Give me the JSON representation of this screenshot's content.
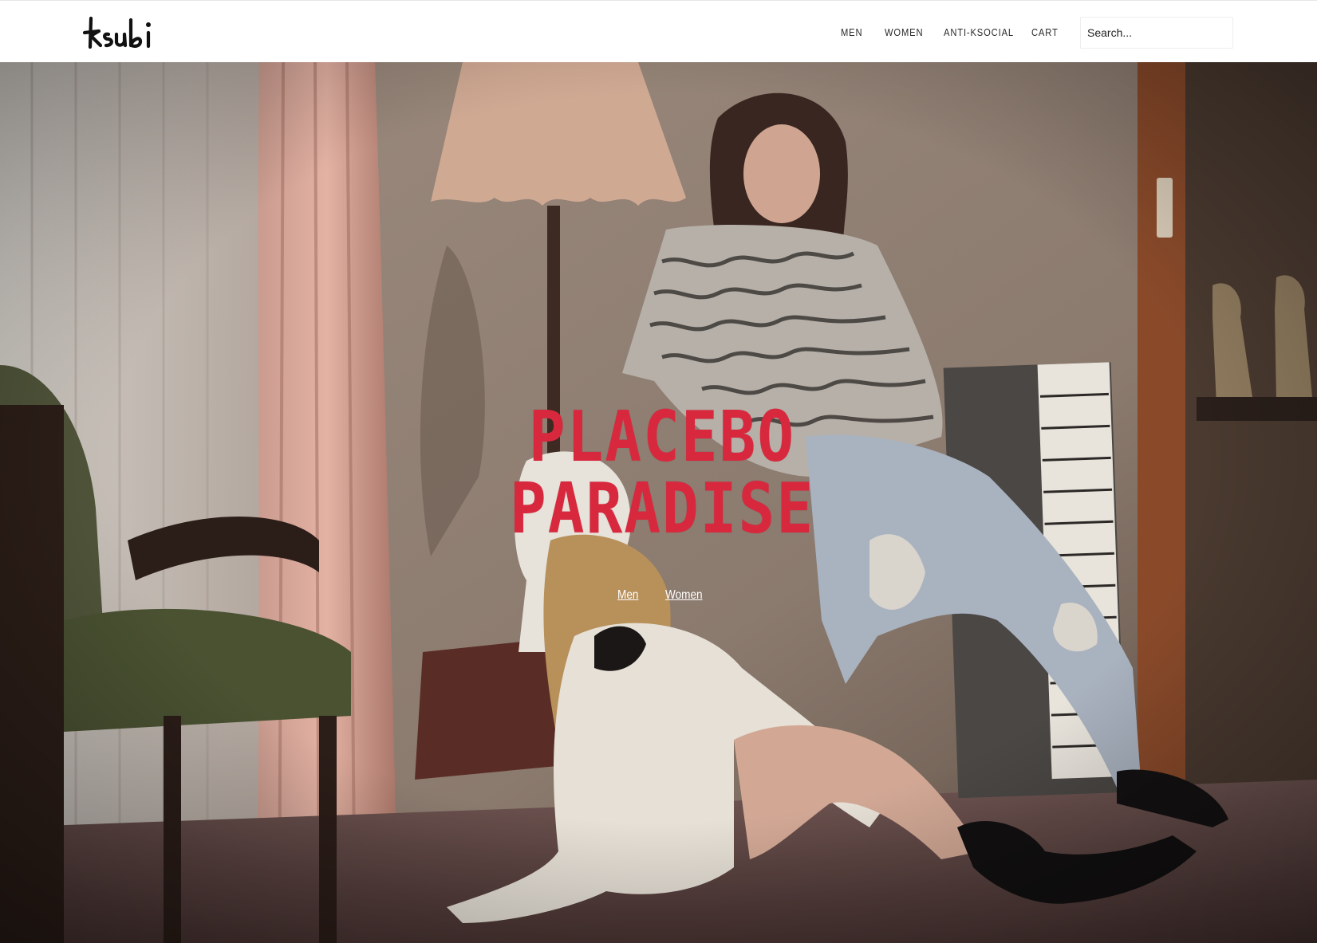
{
  "brand": {
    "name": "ksubi"
  },
  "nav": {
    "items": [
      {
        "label": "MEN"
      },
      {
        "label": "WOMEN"
      },
      {
        "label": "ANTI-KSOCIAL"
      },
      {
        "label": "CART"
      }
    ]
  },
  "search": {
    "placeholder": "Search..."
  },
  "hero": {
    "title_line1": "PLACEBO",
    "title_line2": "PARADISE",
    "links": [
      {
        "label": "Men"
      },
      {
        "label": "Women"
      }
    ]
  },
  "colors": {
    "accent": "#d8283e",
    "header_bg": "#ffffff",
    "nav_text": "#2a2a2a"
  }
}
